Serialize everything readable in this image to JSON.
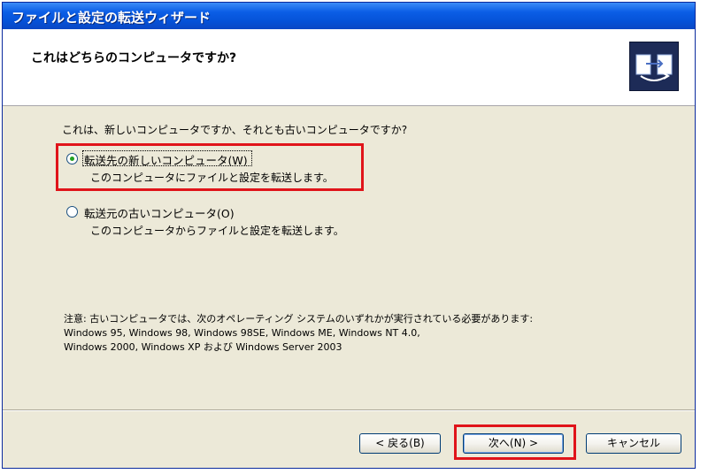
{
  "window": {
    "title": "ファイルと設定の転送ウィザード"
  },
  "header": {
    "heading": "これはどちらのコンピュータですか?",
    "icon": "wizard-transfer-icon"
  },
  "content": {
    "question": "これは、新しいコンピュータですか、それとも古いコンピュータですか?",
    "options": [
      {
        "label": "転送先の新しいコンピュータ(W)",
        "description": "このコンピュータにファイルと設定を転送します。",
        "selected": true
      },
      {
        "label": "転送元の古いコンピュータ(O)",
        "description": "このコンピュータからファイルと設定を転送します。",
        "selected": false
      }
    ],
    "note": {
      "line1": "注意: 古いコンピュータでは、次のオペレーティング システムのいずれかが実行されている必要があります:",
      "line2": "Windows 95, Windows 98, Windows 98SE, Windows ME, Windows NT 4.0,",
      "line3": "Windows 2000, Windows XP および Windows Server 2003"
    }
  },
  "footer": {
    "back_label": "< 戻る(B)",
    "next_label": "次へ(N) >",
    "cancel_label": "キャンセル"
  },
  "colors": {
    "highlight": "#e0141a",
    "titlebar": "#0552d8",
    "dialog_bg": "#ece9d8"
  }
}
